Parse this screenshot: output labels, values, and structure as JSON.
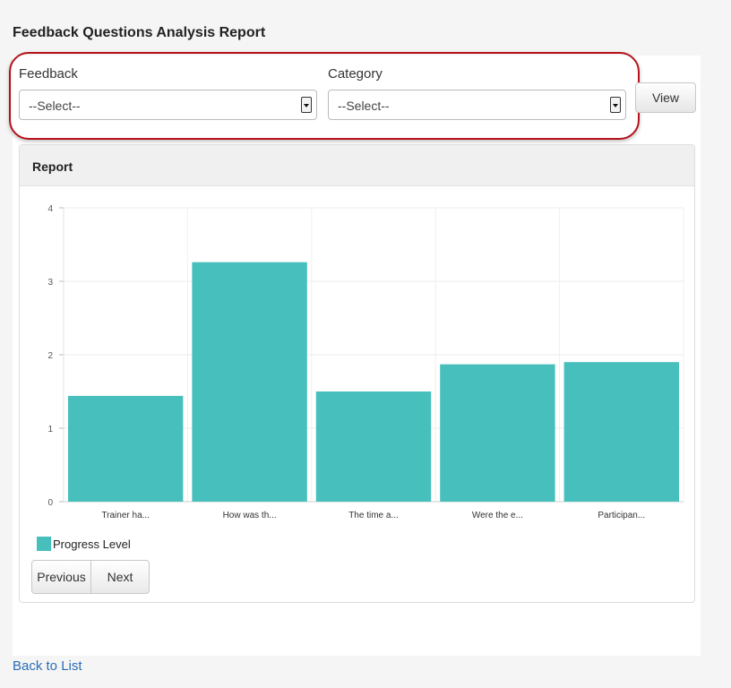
{
  "page": {
    "title": "Feedback Questions Analysis Report"
  },
  "filters": {
    "feedback_label": "Feedback",
    "feedback_value": "--Select--",
    "category_label": "Category",
    "category_value": "--Select--",
    "view_label": "View",
    "highlight_color": "#b5121b"
  },
  "report": {
    "panel_title": "Report",
    "legend_label": "Progress Level",
    "previous_label": "Previous",
    "next_label": "Next"
  },
  "chart_data": {
    "type": "bar",
    "categories": [
      "Trainer ha...",
      "How was th...",
      "The time a...",
      "Were the e...",
      "Participan..."
    ],
    "series": [
      {
        "name": "Progress Level",
        "values": [
          1.44,
          3.26,
          1.5,
          1.87,
          1.9
        ],
        "color": "#47bfbd"
      }
    ],
    "ylim": [
      0,
      4
    ],
    "yticks": [
      0,
      1,
      2,
      3,
      4
    ],
    "grid": true,
    "legend": "bottom-left"
  },
  "footer": {
    "back_label": "Back to List"
  }
}
